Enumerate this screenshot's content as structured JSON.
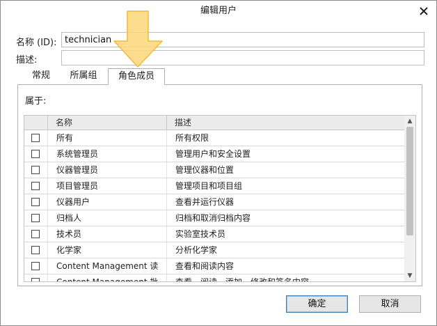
{
  "window": {
    "title": "编辑用户"
  },
  "form": {
    "name_label": "名称 (ID):",
    "name_value": "technician",
    "desc_label": "描述:",
    "desc_value": ""
  },
  "tabs": [
    {
      "label": "常规"
    },
    {
      "label": "所属组"
    },
    {
      "label": "角色成员",
      "active": true
    }
  ],
  "panel": {
    "belongs_label": "属于:"
  },
  "table": {
    "columns": [
      "名称",
      "描述"
    ],
    "rows": [
      {
        "name": "所有",
        "desc": "所有权限"
      },
      {
        "name": "系统管理员",
        "desc": "管理用户和安全设置"
      },
      {
        "name": "仪器管理员",
        "desc": "管理仪器和位置"
      },
      {
        "name": "项目管理员",
        "desc": "管理项目和项目组"
      },
      {
        "name": "仪器用户",
        "desc": "查看并运行仪器"
      },
      {
        "name": "归档人",
        "desc": "归档和取消归档内容"
      },
      {
        "name": "技术员",
        "desc": "实验室技术员"
      },
      {
        "name": "化学家",
        "desc": "分析化学家"
      },
      {
        "name": "Content Management 读",
        "desc": "查看和阅读内容"
      },
      {
        "name": "Content Management 批",
        "desc": "查看、阅读、添加、修改和签名内容"
      }
    ]
  },
  "buttons": {
    "ok": "确定",
    "cancel": "取消"
  },
  "colors": {
    "annotation_arrow": "#fbd77a",
    "annotation_arrow_stroke": "#f2b938",
    "primary_border": "#3c7fb1"
  },
  "icons": {
    "close": "close-icon",
    "scroll_up": "chevron-up-icon",
    "scroll_down": "chevron-down-icon"
  }
}
